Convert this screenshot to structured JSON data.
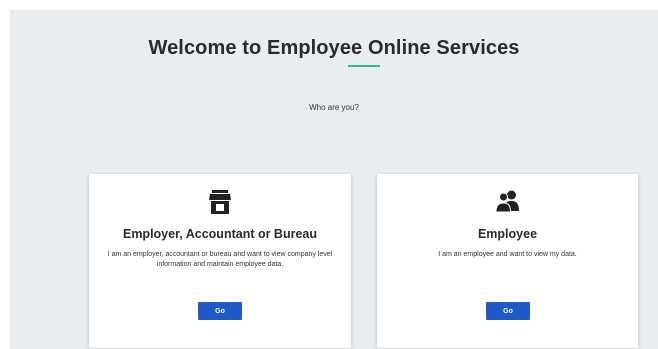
{
  "header": {
    "title": "Welcome to Employee Online Services",
    "subtitle": "Who are you?"
  },
  "colors": {
    "accent": "#35b38a",
    "button": "#1e5bc6",
    "background": "#e9edef"
  },
  "cards": [
    {
      "icon": "store-icon",
      "title": "Employer, Accountant or Bureau",
      "description": "I am an employer, accountant or bureau and want to view company level information and maintain employee data.",
      "button_label": "Go"
    },
    {
      "icon": "people-icon",
      "title": "Employee",
      "description": "I am an employee and want to view my data.",
      "button_label": "Go"
    }
  ]
}
